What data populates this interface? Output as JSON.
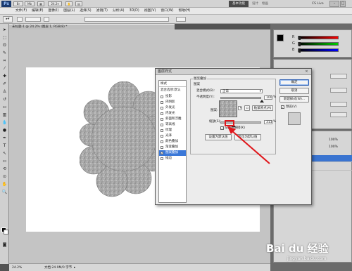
{
  "app": {
    "logo": "Ps",
    "workspace_label": "基本功能",
    "design_label": "设计",
    "painting_label": "绘画",
    "cs_live": "CS Live",
    "window_buttons": [
      "–",
      "□",
      "✕"
    ]
  },
  "menu": [
    "文件(F)",
    "编辑(E)",
    "图像(I)",
    "图层(L)",
    "选择(S)",
    "滤镜(T)",
    "分析(A)",
    "3D(D)",
    "视图(V)",
    "窗口(W)",
    "帮助(H)"
  ],
  "document": {
    "tab_title": "未标题-1 @ 24.2% (图层 1, RGB/8) *",
    "zoom": "24.2%",
    "doc_size": "文档:24.9M/0 字节"
  },
  "dialog": {
    "title": "图层样式",
    "close": "✕",
    "styles_header": "样式",
    "blend_options": "混合选项:默认",
    "style_items": [
      {
        "label": "投影",
        "checked": false
      },
      {
        "label": "内阴影",
        "checked": false
      },
      {
        "label": "外发光",
        "checked": false
      },
      {
        "label": "内发光",
        "checked": false
      },
      {
        "label": "斜面和浮雕",
        "checked": false
      },
      {
        "label": "等高线",
        "checked": false
      },
      {
        "label": "纹理",
        "checked": false
      },
      {
        "label": "光泽",
        "checked": false
      },
      {
        "label": "颜色叠加",
        "checked": false
      },
      {
        "label": "渐变叠加",
        "checked": false
      },
      {
        "label": "图案叠加",
        "checked": true,
        "selected": true
      },
      {
        "label": "描边",
        "checked": false
      }
    ],
    "group_title": "图案叠加",
    "sub_title": "图案",
    "blend_mode_label": "混合模式(B):",
    "blend_mode_value": "正常",
    "opacity_label": "不透明度(Y):",
    "opacity_value": "100",
    "opacity_pct": 1.0,
    "pattern_label": "图案:",
    "snap_button": "贴紧原点(A)",
    "scale_label": "缩放(S):",
    "scale_value": "313",
    "scale_pct": 0.313,
    "percent": "%",
    "link_label": "与图层链接(K)",
    "default_button": "设置为默认值",
    "reset_button": "复位为默认值",
    "ok": "确定",
    "cancel": "取消",
    "new_style": "新建样式(W)...",
    "preview_label": "预览(V)"
  },
  "layers": {
    "rows": [
      "图层 1",
      "背景"
    ],
    "opacity_value": "100%",
    "fill_value": "100%"
  },
  "watermark": {
    "brand": "Bai du 经验",
    "url": "jingyan.baidu.com"
  },
  "colors": {
    "accent_blue": "#3b78d8",
    "annotation_red": "#e0171c",
    "canvas_gray": "#c4c4c4"
  }
}
